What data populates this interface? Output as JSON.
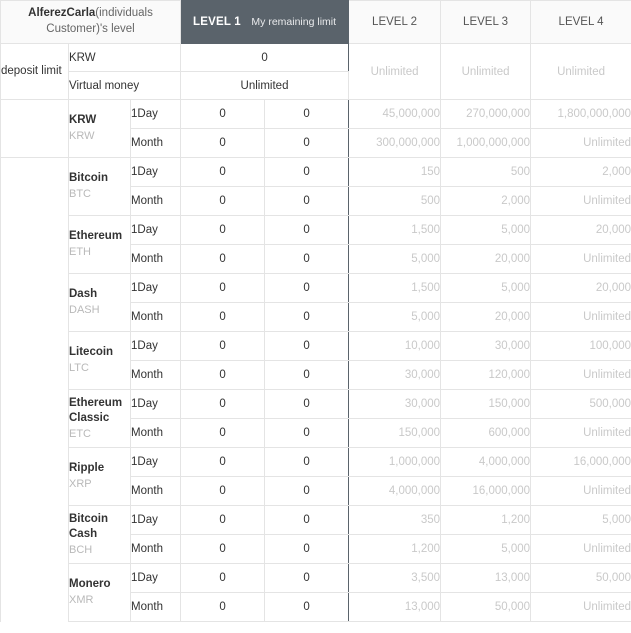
{
  "header": {
    "customer_name": "AlferezCarla",
    "customer_suffix": "(individuals Customer)'s level",
    "level1_label": "LEVEL 1",
    "my_remaining_limit": "My remaining limit",
    "level2_label": "LEVEL 2",
    "level3_label": "LEVEL 3",
    "level4_label": "LEVEL 4",
    "accent_dark": "#5a636b",
    "header_bg": "#fafafa",
    "muted_text": "#c9c9c9"
  },
  "deposit_section": {
    "row_label": "deposit limit",
    "krw_label": "KRW",
    "krw_value": "0",
    "virtual_money_label": "Virtual money",
    "virtual_money_value": "Unlimited",
    "level2_value": "Unlimited",
    "level3_value": "Unlimited",
    "level4_value": "Unlimited"
  },
  "periods": {
    "day": "1Day",
    "month": "Month"
  },
  "coins": [
    {
      "name": "KRW",
      "symbol": "KRW",
      "day": {
        "current": "0",
        "remaining": "0",
        "level2": "45,000,000",
        "level3": "270,000,000",
        "level4": "1,800,000,000"
      },
      "month": {
        "current": "0",
        "remaining": "0",
        "level2": "300,000,000",
        "level3": "1,000,000,000",
        "level4": "Unlimited"
      }
    },
    {
      "name": "Bitcoin",
      "symbol": "BTC",
      "day": {
        "current": "0",
        "remaining": "0",
        "level2": "150",
        "level3": "500",
        "level4": "2,000"
      },
      "month": {
        "current": "0",
        "remaining": "0",
        "level2": "500",
        "level3": "2,000",
        "level4": "Unlimited"
      }
    },
    {
      "name": "Ethereum",
      "symbol": "ETH",
      "day": {
        "current": "0",
        "remaining": "0",
        "level2": "1,500",
        "level3": "5,000",
        "level4": "20,000"
      },
      "month": {
        "current": "0",
        "remaining": "0",
        "level2": "5,000",
        "level3": "20,000",
        "level4": "Unlimited"
      }
    },
    {
      "name": "Dash",
      "symbol": "DASH",
      "day": {
        "current": "0",
        "remaining": "0",
        "level2": "1,500",
        "level3": "5,000",
        "level4": "20,000"
      },
      "month": {
        "current": "0",
        "remaining": "0",
        "level2": "5,000",
        "level3": "20,000",
        "level4": "Unlimited"
      }
    },
    {
      "name": "Litecoin",
      "symbol": "LTC",
      "day": {
        "current": "0",
        "remaining": "0",
        "level2": "10,000",
        "level3": "30,000",
        "level4": "100,000"
      },
      "month": {
        "current": "0",
        "remaining": "0",
        "level2": "30,000",
        "level3": "120,000",
        "level4": "Unlimited"
      }
    },
    {
      "name": "Ethereum Classic",
      "symbol": "ETC",
      "day": {
        "current": "0",
        "remaining": "0",
        "level2": "30,000",
        "level3": "150,000",
        "level4": "500,000"
      },
      "month": {
        "current": "0",
        "remaining": "0",
        "level2": "150,000",
        "level3": "600,000",
        "level4": "Unlimited"
      }
    },
    {
      "name": "Ripple",
      "symbol": "XRP",
      "day": {
        "current": "0",
        "remaining": "0",
        "level2": "1,000,000",
        "level3": "4,000,000",
        "level4": "16,000,000"
      },
      "month": {
        "current": "0",
        "remaining": "0",
        "level2": "4,000,000",
        "level3": "16,000,000",
        "level4": "Unlimited"
      }
    },
    {
      "name": "Bitcoin Cash",
      "symbol": "BCH",
      "day": {
        "current": "0",
        "remaining": "0",
        "level2": "350",
        "level3": "1,200",
        "level4": "5,000"
      },
      "month": {
        "current": "0",
        "remaining": "0",
        "level2": "1,200",
        "level3": "5,000",
        "level4": "Unlimited"
      }
    },
    {
      "name": "Monero",
      "symbol": "XMR",
      "day": {
        "current": "0",
        "remaining": "0",
        "level2": "3,500",
        "level3": "13,000",
        "level4": "50,000"
      },
      "month": {
        "current": "0",
        "remaining": "0",
        "level2": "13,000",
        "level3": "50,000",
        "level4": "Unlimited"
      }
    }
  ]
}
